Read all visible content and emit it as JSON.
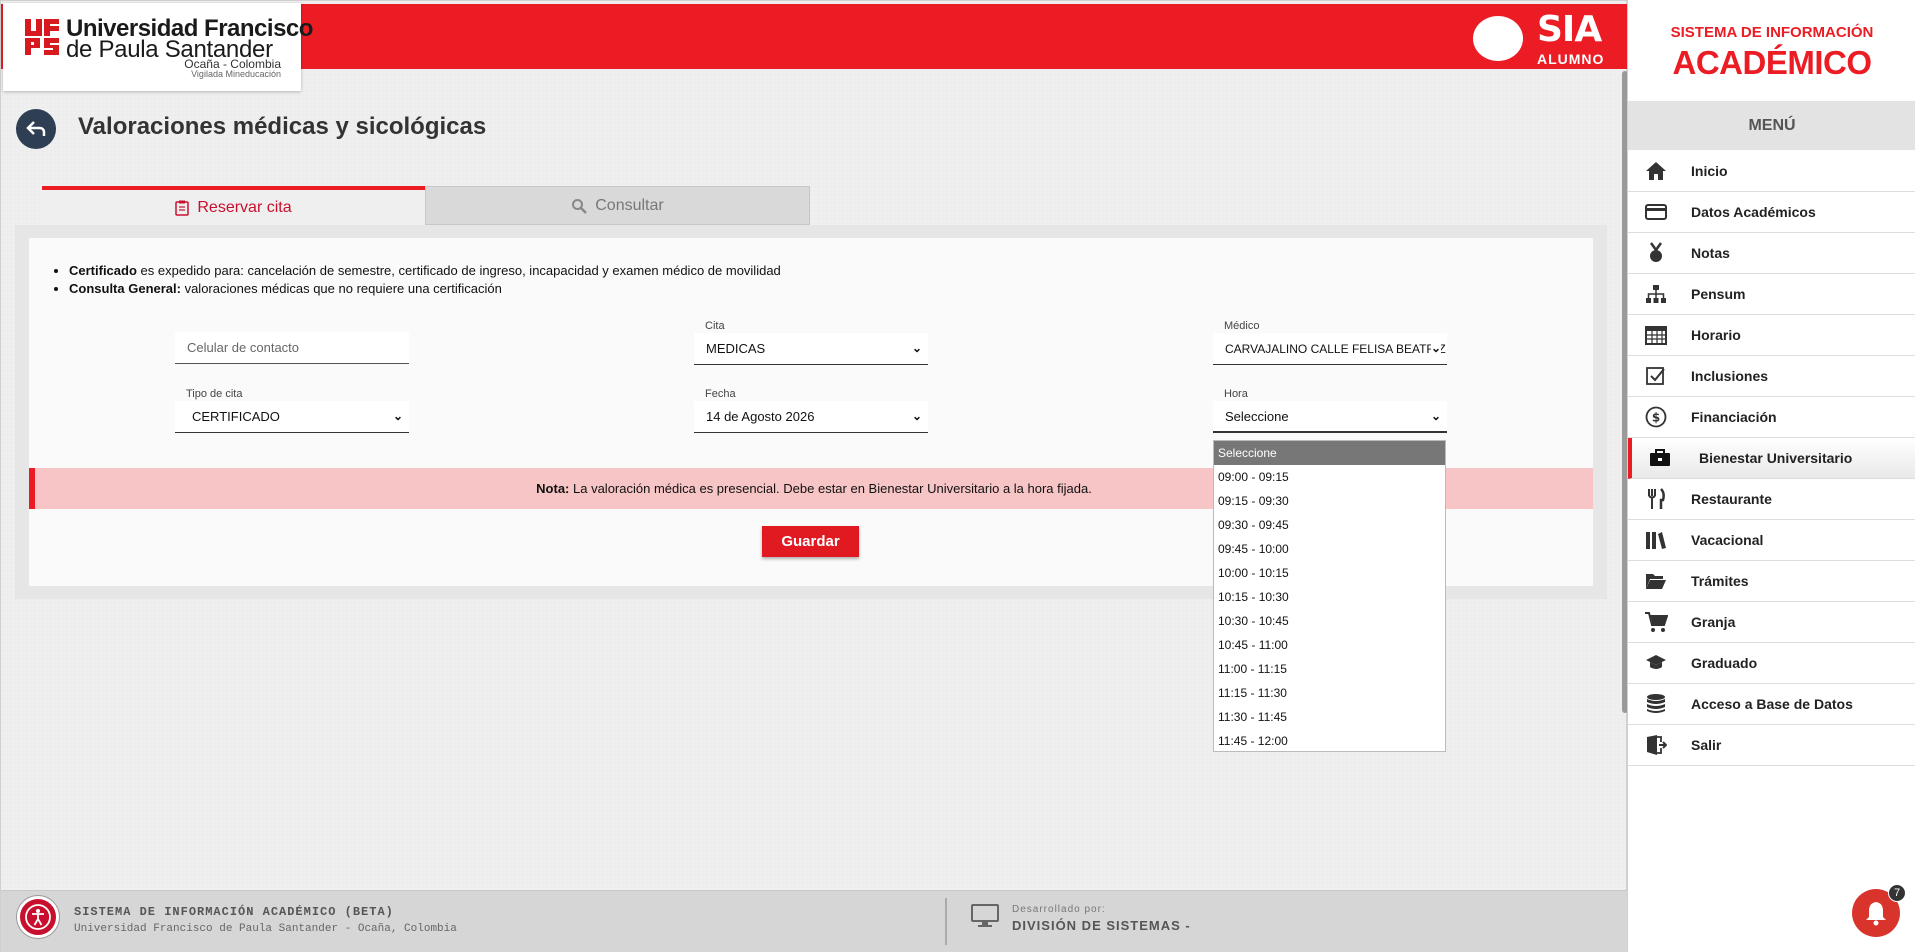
{
  "header": {
    "university_line1": "Universidad Francisco",
    "university_line2": "de Paula Santander",
    "location": "Ocaña - Colombia",
    "vigilada": "Vigilada Mineducación",
    "sia_title": "SIA",
    "sia_subtitle": "ALUMNO"
  },
  "page": {
    "title": "Valoraciones médicas y sicológicas"
  },
  "tabs": [
    {
      "label": "Reservar cita",
      "icon": "clipboard-icon",
      "active": true
    },
    {
      "label": "Consultar",
      "icon": "search-icon",
      "active": false
    }
  ],
  "notes": {
    "item1_bold": "Certificado",
    "item1_text": " es expedido para: cancelación de semestre, certificado de ingreso, incapacidad y examen médico de movilidad",
    "item2_bold": "Consulta General:",
    "item2_text": " valoraciones médicas que no requiere una certificación"
  },
  "form": {
    "celular": {
      "placeholder": "Celular de contacto",
      "value": ""
    },
    "cita": {
      "label": "Cita",
      "value": "MEDICAS"
    },
    "medico": {
      "label": "Médico",
      "value": "CARVAJALINO CALLE FELISA BEATRIZ"
    },
    "tipo_cita": {
      "label": "Tipo de cita",
      "value": "CERTIFICADO"
    },
    "fecha": {
      "label": "Fecha",
      "value": "14 de Agosto 2026"
    },
    "hora": {
      "label": "Hora",
      "value": "Seleccione"
    }
  },
  "hora_options": [
    "Seleccione",
    "09:00 - 09:15",
    "09:15 - 09:30",
    "09:30 - 09:45",
    "09:45 - 10:00",
    "10:00 - 10:15",
    "10:15 - 10:30",
    "10:30 - 10:45",
    "10:45 - 11:00",
    "11:00 - 11:15",
    "11:15 - 11:30",
    "11:30 - 11:45",
    "11:45 - 12:00"
  ],
  "nota": {
    "bold": "Nota:",
    "text": " La valoración médica es presencial. Debe estar en Bienestar Universitario a la hora fijada."
  },
  "actions": {
    "guardar": "Guardar"
  },
  "footer": {
    "line1": "SISTEMA DE INFORMACIÓN ACADÉMICO (BETA)",
    "line2": "Universidad Francisco de Paula Santander - Ocaña, Colombia",
    "dev_label": "Desarrollado por:",
    "dev_name": "DIVISIÓN DE SISTEMAS -"
  },
  "sidebar": {
    "head1": "SISTEMA DE INFORMACIÓN",
    "head2": "ACADÉMICO",
    "menu_title": "MENÚ",
    "items": [
      {
        "label": "Inicio",
        "icon": "home-icon"
      },
      {
        "label": "Datos Académicos",
        "icon": "id-card-icon"
      },
      {
        "label": "Notas",
        "icon": "medal-icon"
      },
      {
        "label": "Pensum",
        "icon": "sitemap-icon"
      },
      {
        "label": "Horario",
        "icon": "calendar-icon"
      },
      {
        "label": "Inclusiones",
        "icon": "checkbox-icon"
      },
      {
        "label": "Financiación",
        "icon": "dollar-icon"
      },
      {
        "label": "Bienestar Universitario",
        "icon": "briefcase-icon",
        "active": true
      },
      {
        "label": "Restaurante",
        "icon": "utensils-icon"
      },
      {
        "label": "Vacacional",
        "icon": "books-icon"
      },
      {
        "label": "Trámites",
        "icon": "folder-open-icon"
      },
      {
        "label": " Granja",
        "icon": "cart-icon"
      },
      {
        "label": "Graduado",
        "icon": "graduation-cap-icon"
      },
      {
        "label": "Acceso a Base de Datos",
        "icon": "database-icon"
      },
      {
        "label": "Salir",
        "icon": "sign-out-icon"
      }
    ]
  },
  "notifications": {
    "count": "7"
  },
  "colors": {
    "brand_red": "#ec1c24",
    "dark_blue": "#2e3e53"
  }
}
